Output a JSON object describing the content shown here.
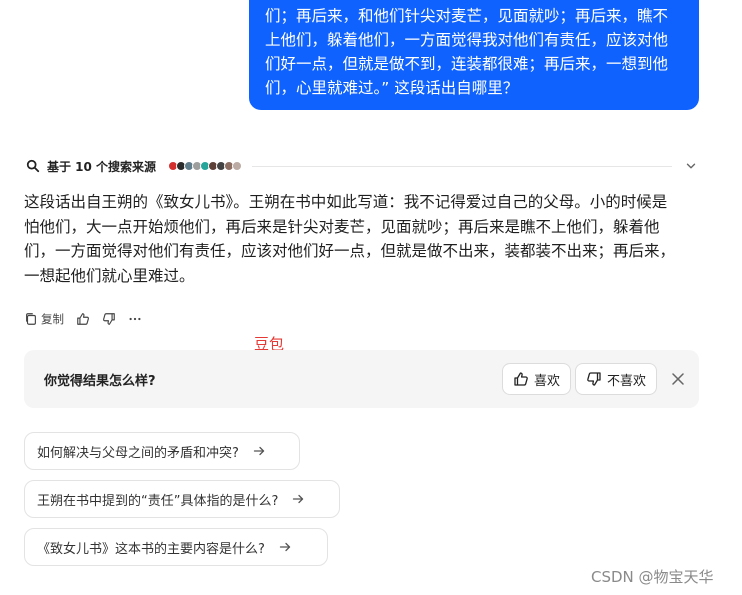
{
  "user_message": {
    "lines": [
      "们；再后来，和他们针尖对麦芒，见面就吵；再后来，瞧不",
      "上他们，躲着他们，一方面觉得我对他们有责任，应该对他",
      "们好一点，但就是做不到，连装都很难；再后来，一想到他",
      "们，心里就难过。” 这段话出自哪里？"
    ]
  },
  "sources": {
    "label": "基于 10 个搜索来源",
    "icons": [
      "source-icon",
      "source-icon",
      "source-icon",
      "source-icon",
      "source-icon",
      "source-icon",
      "source-icon",
      "source-icon",
      "source-icon"
    ],
    "colors": [
      "#d32f2f",
      "#2b2b2b",
      "#607d8b",
      "#9e9e9e",
      "#26a69a",
      "#5d4037",
      "#424242",
      "#8d6e63",
      "#bcaaa4"
    ]
  },
  "answer": {
    "lines": [
      "这段话出自王朔的《致女儿书》。王朔在书中如此写道：我不记得爱过自己的父母。小的时候是",
      "怕他们，大一点开始烦他们，再后来是针尖对麦芒，见面就吵；再后来是瞧不上他们，躲着他",
      "们，一方面觉得对他们有责任，应该对他们好一点，但就是做不出来，装都装不出来；再后来，",
      "一想起他们就心里难过。"
    ]
  },
  "actions": {
    "copy_label": "复制"
  },
  "annotation": "豆包",
  "feedback": {
    "question": "你觉得结果怎么样?",
    "like_label": "喜欢",
    "dislike_label": "不喜欢"
  },
  "suggestions": [
    "如何解决与父母之间的矛盾和冲突?",
    "王朔在书中提到的“责任”具体指的是什么?",
    "《致女儿书》这本书的主要内容是什么?"
  ],
  "watermark": "CSDN @物宝天华",
  "colors": {
    "accent": "#0f62fe",
    "annotation": "#e53935"
  }
}
